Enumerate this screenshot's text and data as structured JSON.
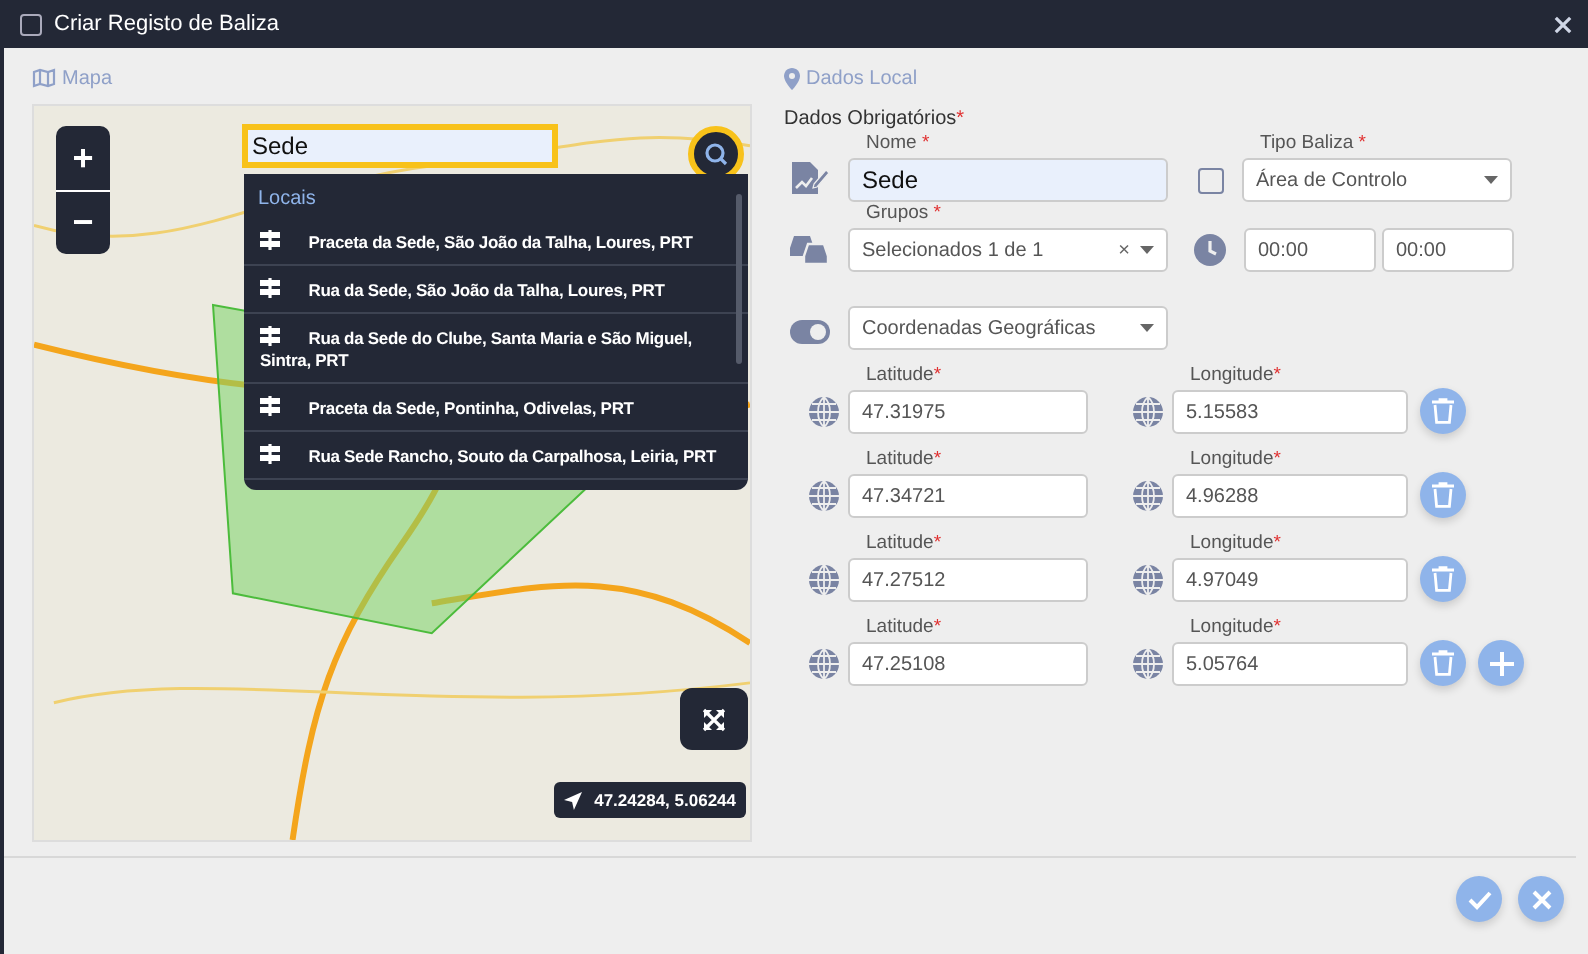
{
  "window": {
    "title": "Criar Registo de Baliza",
    "checked": false
  },
  "map_panel": {
    "heading": "Mapa",
    "search": {
      "value": "Sede"
    },
    "results": {
      "heading": "Locais",
      "items": [
        {
          "label": "Praceta da Sede, São João da Talha, Loures, PRT"
        },
        {
          "label": "Rua da Sede, São João da Talha, Loures, PRT"
        },
        {
          "label": "Rua da Sede do Clube, Santa Maria e São Miguel, Sintra, PRT"
        },
        {
          "label": "Praceta da Sede, Pontinha, Odivelas, PRT"
        },
        {
          "label": "Rua Sede Rancho, Souto da Carpalhosa, Leiria, PRT"
        }
      ]
    },
    "zoom_in": "+",
    "zoom_out": "−",
    "coordinates": "47.24284, 5.06244"
  },
  "form": {
    "heading": "Dados Local",
    "section": "Dados Obrigatórios",
    "required_mark": "*",
    "name": {
      "label": "Nome",
      "value": "Sede"
    },
    "type": {
      "label": "Tipo Baliza",
      "value": "Área de Controlo",
      "checked": false
    },
    "groups": {
      "label": "Grupos",
      "value": "Selecionados 1 de 1",
      "clear": "×"
    },
    "time_from": {
      "value": "00:00"
    },
    "time_to": {
      "value": "00:00"
    },
    "coord_mode": {
      "value": "Coordenadas Geográficas"
    },
    "points": [
      {
        "lat_label": "Latitude",
        "lat": "47.31975",
        "lon_label": "Longitude",
        "lon": "5.15583",
        "add": false
      },
      {
        "lat_label": "Latitude",
        "lat": "47.34721",
        "lon_label": "Longitude",
        "lon": "4.96288",
        "add": false
      },
      {
        "lat_label": "Latitude",
        "lat": "47.27512",
        "lon_label": "Longitude",
        "lon": "4.97049",
        "add": false
      },
      {
        "lat_label": "Latitude",
        "lat": "47.25108",
        "lon_label": "Longitude",
        "lon": "5.05764",
        "add": true
      }
    ]
  }
}
